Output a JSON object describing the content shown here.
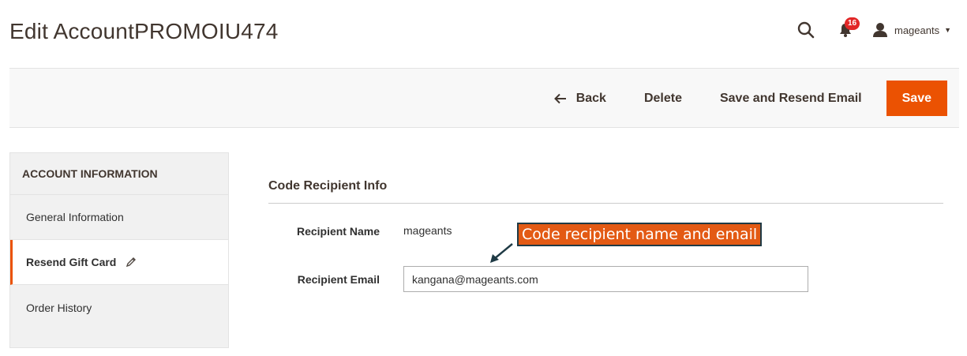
{
  "header": {
    "title": "Edit AccountPROMOIU474",
    "notifications_count": "16",
    "user_name": "mageants"
  },
  "actions": {
    "back_label": "Back",
    "delete_label": "Delete",
    "save_resend_label": "Save and Resend Email",
    "save_label": "Save"
  },
  "sidebar": {
    "heading": "ACCOUNT INFORMATION",
    "items": [
      {
        "label": "General Information"
      },
      {
        "label": "Resend Gift Card"
      },
      {
        "label": "Order History"
      }
    ]
  },
  "section": {
    "title": "Code Recipient Info",
    "recipient_name_label": "Recipient Name",
    "recipient_name_value": "mageants",
    "recipient_email_label": "Recipient Email",
    "recipient_email_value": "kangana@mageants.com"
  },
  "annotation": {
    "text": "Code recipient name and email"
  },
  "colors": {
    "accent": "#eb5202",
    "badge": "#e22626",
    "callout_bg": "#e35a14",
    "callout_border": "#1f3a45"
  }
}
